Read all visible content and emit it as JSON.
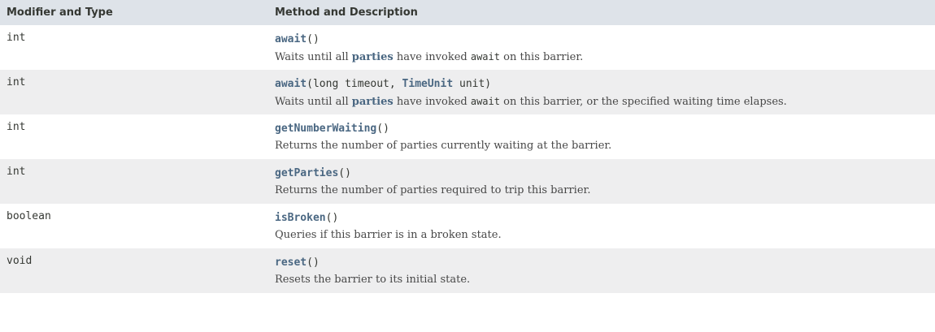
{
  "header": {
    "col_type": "Modifier and Type",
    "col_method": "Method and Description"
  },
  "colors": {
    "header_bg": "#dee3e9",
    "alt_row_bg": "#eeeeef",
    "link": "#4a6782",
    "text": "#353833"
  },
  "rows": [
    {
      "type": "int",
      "method_name": "await",
      "params_open": "(",
      "params_close": ")",
      "desc_before": "Waits until all ",
      "desc_link": "parties",
      "desc_mid": " have invoked ",
      "desc_code": "await",
      "desc_after": " on this barrier."
    },
    {
      "type": "int",
      "method_name": "await",
      "params_open": "(long timeout, ",
      "param_type_link": "TimeUnit",
      "params_close": " unit)",
      "desc_before": "Waits until all ",
      "desc_link": "parties",
      "desc_mid": " have invoked ",
      "desc_code": "await",
      "desc_after": " on this barrier, or the specified waiting time elapses."
    },
    {
      "type": "int",
      "method_name": "getNumberWaiting",
      "params_open": "(",
      "params_close": ")",
      "desc": "Returns the number of parties currently waiting at the barrier."
    },
    {
      "type": "int",
      "method_name": "getParties",
      "params_open": "(",
      "params_close": ")",
      "desc": "Returns the number of parties required to trip this barrier."
    },
    {
      "type": "boolean",
      "method_name": "isBroken",
      "params_open": "(",
      "params_close": ")",
      "desc": "Queries if this barrier is in a broken state."
    },
    {
      "type": "void",
      "method_name": "reset",
      "params_open": "(",
      "params_close": ")",
      "desc": "Resets the barrier to its initial state."
    }
  ]
}
